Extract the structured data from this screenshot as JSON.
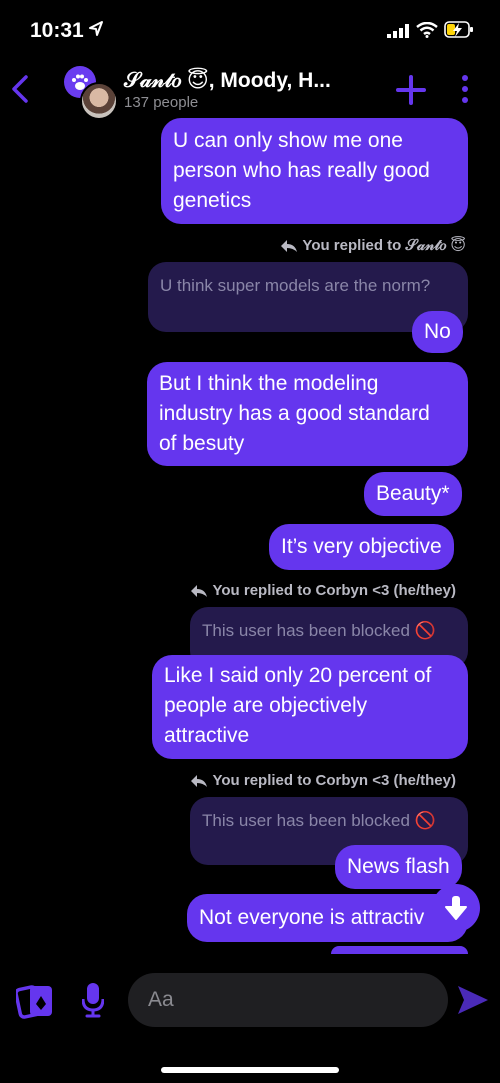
{
  "status_bar": {
    "time": "10:31",
    "battery_level": 0.4
  },
  "header": {
    "title": "𝒮𝒶𝓃𝓉𝑜 😇, Moody, H...",
    "subtitle": "137 people"
  },
  "messages": [
    {
      "type": "bubble",
      "lines": [
        "U can only show me one",
        "person who has really good",
        "genetics"
      ]
    },
    {
      "type": "reply_label",
      "text": "You replied to 𝒮𝒶𝓃𝓉𝑜 😇"
    },
    {
      "type": "quote",
      "text": "U think super models are the norm?"
    },
    {
      "type": "bubble",
      "lines": [
        "No"
      ]
    },
    {
      "type": "bubble",
      "lines": [
        "But I think the modeling",
        "industry has a good standard",
        "of besuty"
      ]
    },
    {
      "type": "bubble",
      "lines": [
        "Beauty*"
      ]
    },
    {
      "type": "bubble",
      "lines": [
        "It’s very objective"
      ]
    },
    {
      "type": "reply_label",
      "text": "You replied to Corbyn <3 (he/they)"
    },
    {
      "type": "quote",
      "text": "This user has been blocked 🚫"
    },
    {
      "type": "bubble",
      "lines": [
        "Like I said only 20 percent of",
        "people are objectively",
        "attractive"
      ]
    },
    {
      "type": "reply_label",
      "text": "You replied to Corbyn <3 (he/they)"
    },
    {
      "type": "quote",
      "text": "This user has been blocked 🚫"
    },
    {
      "type": "bubble",
      "lines": [
        "News flash"
      ]
    },
    {
      "type": "bubble",
      "lines": [
        "Not everyone is attractiv"
      ]
    }
  ],
  "composer": {
    "placeholder": "Aa"
  },
  "colors": {
    "accent": "#6536ee",
    "quote_bg": "#241a4c",
    "background": "#000000"
  },
  "icons": [
    "location-arrow-icon",
    "signal-icon",
    "wifi-icon",
    "battery-charging-icon",
    "back-chevron-icon",
    "paw-icon",
    "plus-icon",
    "more-dots-icon",
    "reply-arrow-icon",
    "scroll-down-icon",
    "cards-icon",
    "microphone-icon",
    "send-icon"
  ]
}
